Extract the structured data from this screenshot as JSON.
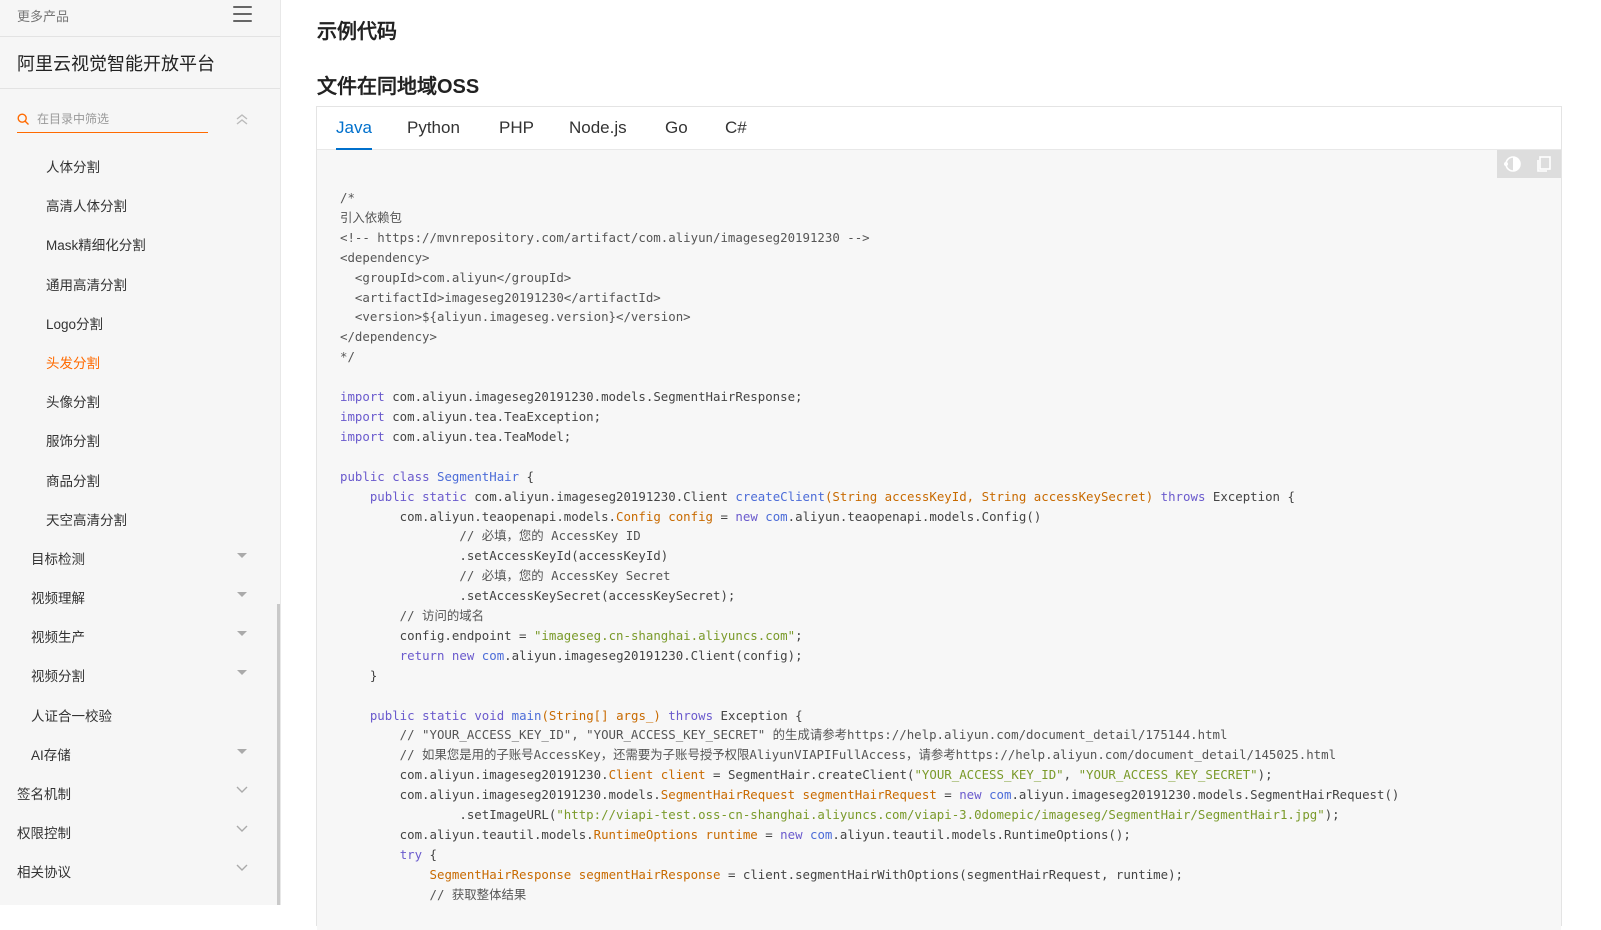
{
  "sidebar": {
    "more_products": "更多产品",
    "title": "阿里云视觉智能开放平台",
    "filter_placeholder": "在目录中筛选",
    "items": [
      {
        "label": "人体分割",
        "level": 3,
        "active": false,
        "expand": "none"
      },
      {
        "label": "高清人体分割",
        "level": 3,
        "active": false,
        "expand": "none"
      },
      {
        "label": "Mask精细化分割",
        "level": 3,
        "active": false,
        "expand": "none"
      },
      {
        "label": "通用高清分割",
        "level": 3,
        "active": false,
        "expand": "none"
      },
      {
        "label": "Logo分割",
        "level": 3,
        "active": false,
        "expand": "none"
      },
      {
        "label": "头发分割",
        "level": 3,
        "active": true,
        "expand": "none"
      },
      {
        "label": "头像分割",
        "level": 3,
        "active": false,
        "expand": "none"
      },
      {
        "label": "服饰分割",
        "level": 3,
        "active": false,
        "expand": "none"
      },
      {
        "label": "商品分割",
        "level": 3,
        "active": false,
        "expand": "none"
      },
      {
        "label": "天空高清分割",
        "level": 3,
        "active": false,
        "expand": "none"
      },
      {
        "label": "目标检测",
        "level": 2,
        "active": false,
        "expand": "caret"
      },
      {
        "label": "视频理解",
        "level": 2,
        "active": false,
        "expand": "caret"
      },
      {
        "label": "视频生产",
        "level": 2,
        "active": false,
        "expand": "caret"
      },
      {
        "label": "视频分割",
        "level": 2,
        "active": false,
        "expand": "caret"
      },
      {
        "label": "人证合一校验",
        "level": 2,
        "active": false,
        "expand": "none"
      },
      {
        "label": "AI存储",
        "level": 2,
        "active": false,
        "expand": "caret"
      },
      {
        "label": "签名机制",
        "level": 1,
        "active": false,
        "expand": "chevron"
      },
      {
        "label": "权限控制",
        "level": 1,
        "active": false,
        "expand": "chevron"
      },
      {
        "label": "相关协议",
        "level": 1,
        "active": false,
        "expand": "chevron"
      }
    ]
  },
  "main": {
    "heading_example": "示例代码",
    "heading_oss": "文件在同地域OSS",
    "tabs": [
      {
        "label": "Java",
        "active": true
      },
      {
        "label": "Python",
        "active": false
      },
      {
        "label": "PHP",
        "active": false
      },
      {
        "label": "Node.js",
        "active": false
      },
      {
        "label": "Go",
        "active": false
      },
      {
        "label": "C#",
        "active": false
      }
    ]
  },
  "code_lines": [
    [
      [
        "cm",
        "/*"
      ]
    ],
    [
      [
        "cm",
        "引入依赖包"
      ]
    ],
    [
      [
        "cm",
        "<!-- https://mvnrepository.com/artifact/com.aliyun/imageseg20191230 -->"
      ]
    ],
    [
      [
        "cm",
        "<dependency>"
      ]
    ],
    [
      [
        "cm",
        "  <groupId>com.aliyun</groupId>"
      ]
    ],
    [
      [
        "cm",
        "  <artifactId>imageseg20191230</artifactId>"
      ]
    ],
    [
      [
        "cm",
        "  <version>${aliyun.imageseg.version}</version>"
      ]
    ],
    [
      [
        "cm",
        "</dependency>"
      ]
    ],
    [
      [
        "cm",
        "*/"
      ]
    ],
    [],
    [
      [
        "kw",
        "import"
      ],
      [
        "t",
        " com.aliyun.imageseg20191230.models.SegmentHairResponse;"
      ]
    ],
    [
      [
        "kw",
        "import"
      ],
      [
        "t",
        " com.aliyun.tea.TeaException;"
      ]
    ],
    [
      [
        "kw",
        "import"
      ],
      [
        "t",
        " com.aliyun.tea.TeaModel;"
      ]
    ],
    [],
    [
      [
        "kw",
        "public"
      ],
      [
        "t",
        " "
      ],
      [
        "kw",
        "class"
      ],
      [
        "t",
        " "
      ],
      [
        "fn",
        "SegmentHair"
      ],
      [
        "t",
        " {"
      ]
    ],
    [
      [
        "t",
        "    "
      ],
      [
        "kw",
        "public"
      ],
      [
        "t",
        " "
      ],
      [
        "kw",
        "static"
      ],
      [
        "t",
        " com.aliyun.imageseg20191230.Client "
      ],
      [
        "fn",
        "createClient"
      ],
      [
        "ty",
        "(String accessKeyId, String accessKeySecret)"
      ],
      [
        "t",
        " "
      ],
      [
        "kw",
        "throws"
      ],
      [
        "t",
        " Exception {"
      ]
    ],
    [
      [
        "t",
        "        com.aliyun.teaopenapi.models."
      ],
      [
        "ty",
        "Config"
      ],
      [
        "t",
        " "
      ],
      [
        "ty",
        "config"
      ],
      [
        "t",
        " = "
      ],
      [
        "kw",
        "new"
      ],
      [
        "t",
        " "
      ],
      [
        "fn",
        "com"
      ],
      [
        "t",
        ".aliyun.teaopenapi.models.Config()"
      ]
    ],
    [
      [
        "cm",
        "                // 必填，您的 AccessKey ID"
      ]
    ],
    [
      [
        "t",
        "                .setAccessKeyId(accessKeyId)"
      ]
    ],
    [
      [
        "cm",
        "                // 必填，您的 AccessKey Secret"
      ]
    ],
    [
      [
        "t",
        "                .setAccessKeySecret(accessKeySecret);"
      ]
    ],
    [
      [
        "cm",
        "        // 访问的域名"
      ]
    ],
    [
      [
        "t",
        "        config.endpoint = "
      ],
      [
        "str",
        "\"imageseg.cn-shanghai.aliyuncs.com\""
      ],
      [
        "t",
        ";"
      ]
    ],
    [
      [
        "t",
        "        "
      ],
      [
        "kw",
        "return"
      ],
      [
        "t",
        " "
      ],
      [
        "kw",
        "new"
      ],
      [
        "t",
        " "
      ],
      [
        "fn",
        "com"
      ],
      [
        "t",
        ".aliyun.imageseg20191230.Client(config);"
      ]
    ],
    [
      [
        "t",
        "    }"
      ]
    ],
    [],
    [
      [
        "t",
        "    "
      ],
      [
        "kw",
        "public"
      ],
      [
        "t",
        " "
      ],
      [
        "kw",
        "static"
      ],
      [
        "t",
        " "
      ],
      [
        "kw",
        "void"
      ],
      [
        "t",
        " "
      ],
      [
        "fn",
        "main"
      ],
      [
        "ty",
        "(String[] args_)"
      ],
      [
        "t",
        " "
      ],
      [
        "kw",
        "throws"
      ],
      [
        "t",
        " Exception {"
      ]
    ],
    [
      [
        "cm",
        "        // \"YOUR_ACCESS_KEY_ID\", \"YOUR_ACCESS_KEY_SECRET\" 的生成请参考https://help.aliyun.com/document_detail/175144.html"
      ]
    ],
    [
      [
        "cm",
        "        // 如果您是用的子账号AccessKey，还需要为子账号授予权限AliyunVIAPIFullAccess，请参考https://help.aliyun.com/document_detail/145025.html"
      ]
    ],
    [
      [
        "t",
        "        com.aliyun.imageseg20191230."
      ],
      [
        "ty",
        "Client"
      ],
      [
        "t",
        " "
      ],
      [
        "ty",
        "client"
      ],
      [
        "t",
        " = SegmentHair.createClient("
      ],
      [
        "str",
        "\"YOUR_ACCESS_KEY_ID\""
      ],
      [
        "t",
        ", "
      ],
      [
        "str",
        "\"YOUR_ACCESS_KEY_SECRET\""
      ],
      [
        "t",
        ");"
      ]
    ],
    [
      [
        "t",
        "        com.aliyun.imageseg20191230.models."
      ],
      [
        "ty",
        "SegmentHairRequest"
      ],
      [
        "t",
        " "
      ],
      [
        "ty",
        "segmentHairRequest"
      ],
      [
        "t",
        " = "
      ],
      [
        "kw",
        "new"
      ],
      [
        "t",
        " "
      ],
      [
        "fn",
        "com"
      ],
      [
        "t",
        ".aliyun.imageseg20191230.models.SegmentHairRequest()"
      ]
    ],
    [
      [
        "t",
        "                .setImageURL("
      ],
      [
        "str",
        "\"http://viapi-test.oss-cn-shanghai.aliyuncs.com/viapi-3.0domepic/imageseg/SegmentHair/SegmentHair1.jpg\""
      ],
      [
        "t",
        ");"
      ]
    ],
    [
      [
        "t",
        "        com.aliyun.teautil.models."
      ],
      [
        "ty",
        "RuntimeOptions"
      ],
      [
        "t",
        " "
      ],
      [
        "ty",
        "runtime"
      ],
      [
        "t",
        " = "
      ],
      [
        "kw",
        "new"
      ],
      [
        "t",
        " "
      ],
      [
        "fn",
        "com"
      ],
      [
        "t",
        ".aliyun.teautil.models.RuntimeOptions();"
      ]
    ],
    [
      [
        "t",
        "        "
      ],
      [
        "kw",
        "try"
      ],
      [
        "t",
        " {"
      ]
    ],
    [
      [
        "t",
        "            "
      ],
      [
        "ty",
        "SegmentHairResponse"
      ],
      [
        "t",
        " "
      ],
      [
        "ty",
        "segmentHairResponse"
      ],
      [
        "t",
        " = client.segmentHairWithOptions(segmentHairRequest, runtime);"
      ]
    ],
    [
      [
        "cm",
        "            // 获取整体结果"
      ]
    ]
  ]
}
